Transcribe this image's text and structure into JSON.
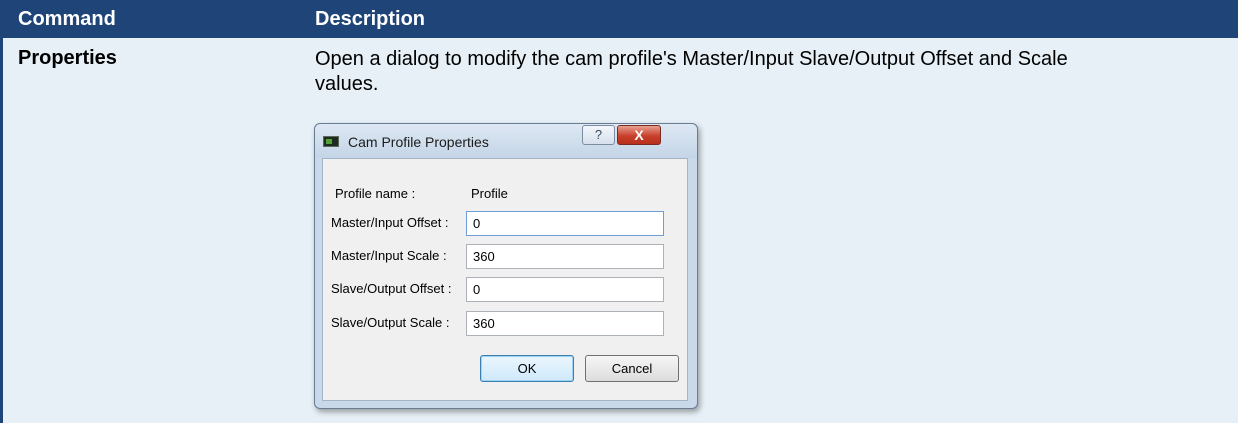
{
  "table": {
    "headers": {
      "command": "Command",
      "description": "Description"
    },
    "row": {
      "command": "Properties",
      "description": "Open a dialog to modify the cam profile's Master/Input Slave/Output Offset and Scale values."
    }
  },
  "dialog": {
    "title": "Cam Profile Properties",
    "help_glyph": "?",
    "close_glyph": "X",
    "profile_name_label": "Profile name :",
    "profile_name_value": "Profile",
    "fields": [
      {
        "label": "Master/Input Offset :",
        "value": "0"
      },
      {
        "label": "Master/Input Scale :",
        "value": "360"
      },
      {
        "label": "Slave/Output Offset :",
        "value": "0"
      },
      {
        "label": "Slave/Output Scale :",
        "value": "360"
      }
    ],
    "ok_label": "OK",
    "cancel_label": "Cancel"
  },
  "colors": {
    "header_bg": "#1f4478",
    "row_bg": "#e6f0f6",
    "close_button": "#c8402c"
  },
  "icons": {
    "app": "app-window-icon",
    "help": "help-icon",
    "close": "close-icon"
  }
}
